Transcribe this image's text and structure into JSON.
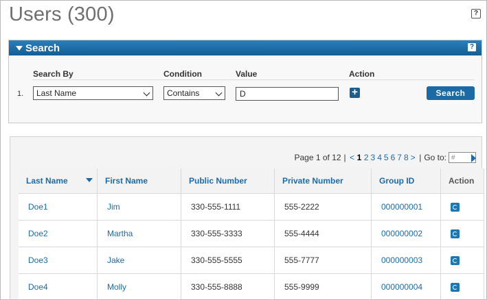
{
  "page": {
    "title": "Users (300)",
    "help_label": "?"
  },
  "search": {
    "header": "Search",
    "help_label": "?",
    "columns": {
      "search_by": "Search By",
      "condition": "Condition",
      "value": "Value",
      "action": "Action"
    },
    "row": {
      "index": "1.",
      "search_by_value": "Last Name",
      "condition_value": "Contains",
      "value": "D",
      "add_label": "+"
    },
    "button_label": "Search"
  },
  "pager": {
    "page_text": "Page 1 of 12",
    "sep": "|",
    "prev": "<",
    "current": "1",
    "pages": [
      "2",
      "3",
      "4",
      "5",
      "6",
      "7",
      "8"
    ],
    "next": ">",
    "goto_label": "Go to:",
    "goto_placeholder": "#"
  },
  "table": {
    "headers": [
      "Last Name",
      "First Name",
      "Public Number",
      "Private Number",
      "Group ID",
      "Action"
    ],
    "rows": [
      {
        "last": "Doe1",
        "first": "Jim",
        "public": "330-555-1111",
        "private": "555-2222",
        "group": "000000001"
      },
      {
        "last": "Doe2",
        "first": "Martha",
        "public": "330-555-3333",
        "private": "555-4444",
        "group": "000000002"
      },
      {
        "last": "Doe3",
        "first": "Jake",
        "public": "330-555-5555",
        "private": "555-7777",
        "group": "000000003"
      },
      {
        "last": "Doe4",
        "first": "Molly",
        "public": "330-555-8888",
        "private": "555-9999",
        "group": "000000004"
      }
    ]
  },
  "colors": {
    "accent": "#1c6aa8",
    "header_bar": "#135d93"
  }
}
